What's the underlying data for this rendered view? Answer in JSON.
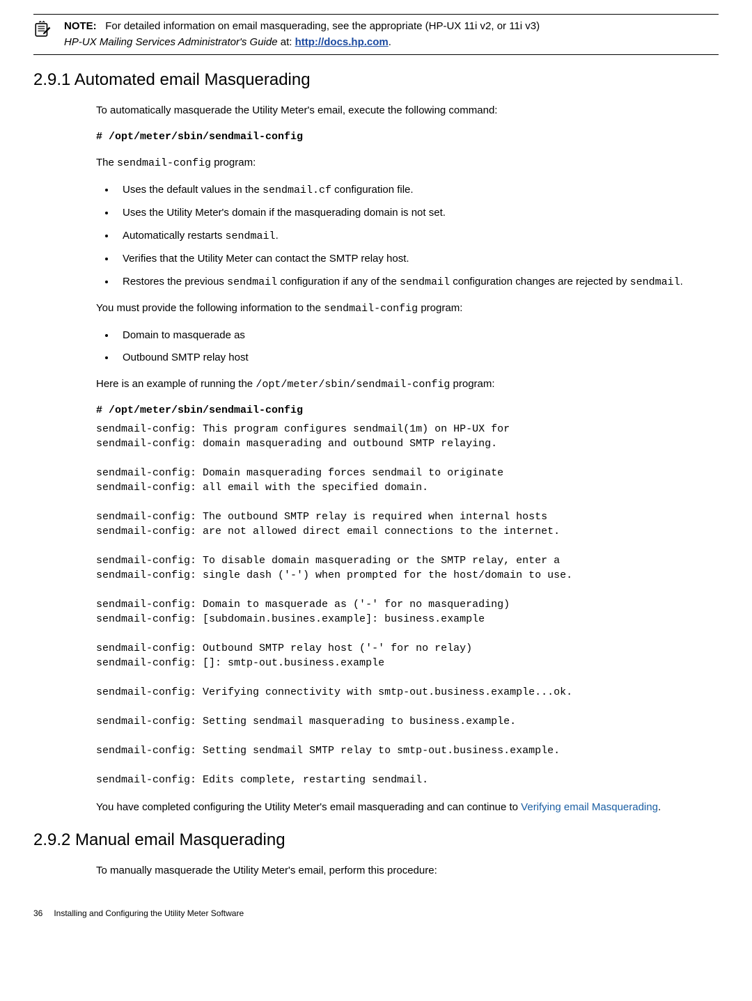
{
  "note": {
    "label": "NOTE:",
    "line1_prefix": "For detailed information on email masquerading, see the appropriate (HP-UX 11i v2, or 11i v3)",
    "line2_italic": "HP-UX Mailing Services Administrator's Guide",
    "line2_mid": " at: ",
    "link": "http://docs.hp.com",
    "line2_end": "."
  },
  "sec1": {
    "heading": "2.9.1 Automated email Masquerading",
    "intro": "To automatically masquerade the Utility Meter's email, execute the following command:",
    "cmd1": "# /opt/meter/sbin/sendmail-config",
    "p2a": "The ",
    "p2b": "sendmail-config",
    "p2c": " program:",
    "b1a": "Uses the default values in the ",
    "b1b": "sendmail.cf",
    "b1c": " configuration file.",
    "b2": "Uses the Utility Meter's domain if the masquerading domain is not set.",
    "b3a": "Automatically restarts ",
    "b3b": "sendmail",
    "b3c": ".",
    "b4": "Verifies that the Utility Meter can contact the SMTP relay host.",
    "b5a": "Restores the previous ",
    "b5b": "sendmail",
    "b5c": " configuration if any of the ",
    "b5d": "sendmail",
    "b5e": " configuration changes are rejected by ",
    "b5f": "sendmail",
    "b5g": ".",
    "p3a": "You must provide the following information to the ",
    "p3b": "sendmail-config",
    "p3c": " program:",
    "b6": "Domain to masquerade as",
    "b7": "Outbound SMTP relay host",
    "p4a": "Here is an example of running the ",
    "p4b": "/opt/meter/sbin/sendmail-config",
    "p4c": " program:",
    "cmd2": "# /opt/meter/sbin/sendmail-config",
    "codeblock": "sendmail-config: This program configures sendmail(1m) on HP-UX for\nsendmail-config: domain masquerading and outbound SMTP relaying.\n\nsendmail-config: Domain masquerading forces sendmail to originate\nsendmail-config: all email with the specified domain.\n\nsendmail-config: The outbound SMTP relay is required when internal hosts\nsendmail-config: are not allowed direct email connections to the internet.\n\nsendmail-config: To disable domain masquerading or the SMTP relay, enter a\nsendmail-config: single dash ('-') when prompted for the host/domain to use.\n\nsendmail-config: Domain to masquerade as ('-' for no masquerading)\nsendmail-config: [subdomain.busines.example]: business.example\n\nsendmail-config: Outbound SMTP relay host ('-' for no relay)\nsendmail-config: []: smtp-out.business.example\n\nsendmail-config: Verifying connectivity with smtp-out.business.example...ok.\n\nsendmail-config: Setting sendmail masquerading to business.example.\n\nsendmail-config: Setting sendmail SMTP relay to smtp-out.business.example.\n\nsendmail-config: Edits complete, restarting sendmail.",
    "p5a": "You have completed configuring the Utility Meter's email masquerading and can continue to ",
    "p5link": "Verifying email Masquerading",
    "p5c": "."
  },
  "sec2": {
    "heading": "2.9.2 Manual email Masquerading",
    "intro": "To manually masquerade the Utility Meter's email, perform this procedure:"
  },
  "footer": {
    "page": "36",
    "title": "Installing and Configuring the Utility Meter Software"
  }
}
